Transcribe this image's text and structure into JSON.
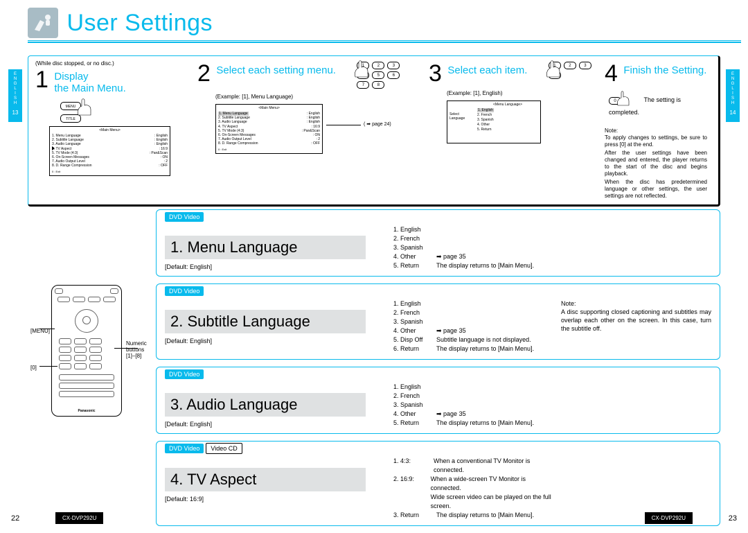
{
  "header": {
    "title": "User Settings"
  },
  "side": {
    "lang": "E\nN\nG\nL\nI\nS\nH",
    "page_left": "13",
    "page_right": "14"
  },
  "steps": {
    "s1": {
      "num": "1",
      "hint": "(While disc stopped, or no disc.)",
      "text": "Display\nthe Main Menu."
    },
    "s2": {
      "num": "2",
      "text": "Select each setting menu.",
      "example": "(Example: [1], Menu Language)",
      "ref": "( ➡ page 24)"
    },
    "s3": {
      "num": "3",
      "text": "Select each item.",
      "example": "(Example: [1], English)"
    },
    "s4": {
      "num": "4",
      "text": "Finish the Setting.",
      "done": "The setting is completed.",
      "note_label": "Note:",
      "note1": "To apply changes to settings, be sure to press [0] at the end.",
      "note2": "After the user settings have been changed and entered, the player returns to the start of the disc and begins playback.",
      "note3": "When the disc has predetermined language or other settings, the user settings are not reflected."
    },
    "menu_key": "MENU",
    "title_key": "TITLE",
    "kp": [
      "1",
      "2",
      "3",
      "4",
      "5",
      "6",
      "7",
      "8"
    ],
    "kp_short": [
      "1",
      "2",
      "3",
      "4"
    ],
    "kp_zero": "0"
  },
  "osd_main": {
    "title": "<Main Menu>",
    "rows": [
      [
        "1. Menu Language",
        "English"
      ],
      [
        "2. Subtitle Language",
        "English"
      ],
      [
        "3. Audio Language",
        "English"
      ],
      [
        "4. TV Aspect",
        "16:9"
      ],
      [
        "5. TV Mode (4:3)",
        "Pan&Scan"
      ],
      [
        "6. On-Screen Messages",
        "ON"
      ],
      [
        "7. Audio Output Level",
        "2"
      ],
      [
        "8. D. Range Compression",
        "OFF"
      ]
    ],
    "foot": "0 : Exit"
  },
  "osd_lang": {
    "title": "<Menu Language>",
    "label": "Select\nLanguage",
    "rows": [
      "1. English",
      "2. French",
      "3. Spanish",
      "4. Other",
      "5. Return"
    ]
  },
  "remote": {
    "label_menu": "[MENU]",
    "label_zero": "[0]",
    "label_num": "Numeric\nbuttons\n[1]–[8]"
  },
  "badges": {
    "dvd": "DVD Video",
    "vcd": "Video CD"
  },
  "settings": [
    {
      "title": "1. Menu Language",
      "default": "[Default: English]",
      "opts": [
        [
          "1. English",
          ""
        ],
        [
          "2. French",
          ""
        ],
        [
          "3. Spanish",
          ""
        ],
        [
          "4. Other",
          "➡ page 35"
        ],
        [
          "5. Return",
          "The display returns to [Main Menu]."
        ]
      ],
      "badges": [
        "dvd"
      ]
    },
    {
      "title": "2. Subtitle Language",
      "default": "[Default: English]",
      "opts": [
        [
          "1. English",
          ""
        ],
        [
          "2. French",
          ""
        ],
        [
          "3. Spanish",
          ""
        ],
        [
          "4. Other",
          "➡ page 35"
        ],
        [
          "5. Disp Off",
          "Subtitle language is not displayed."
        ],
        [
          "6. Return",
          "The display returns to [Main Menu]."
        ]
      ],
      "note_label": "Note:",
      "note": "A disc supporting closed captioning and subtitles may overlap each other on the screen. In this case, turn the subtitle off.",
      "badges": [
        "dvd"
      ]
    },
    {
      "title": "3. Audio Language",
      "default": "[Default: English]",
      "opts": [
        [
          "1. English",
          ""
        ],
        [
          "2. French",
          ""
        ],
        [
          "3. Spanish",
          ""
        ],
        [
          "4. Other",
          "➡ page 35"
        ],
        [
          "5. Return",
          "The display returns to [Main Menu]."
        ]
      ],
      "badges": [
        "dvd"
      ]
    },
    {
      "title": "4. TV Aspect",
      "default": "[Default: 16:9]",
      "opts": [
        [
          "1. 4:3:",
          "When a conventional TV Monitor is connected."
        ],
        [
          "2. 16:9:",
          "When a wide-screen TV Monitor is connected.\nWide screen video can be played on the full screen."
        ],
        [
          "3. Return",
          "The display returns to [Main Menu]."
        ]
      ],
      "badges": [
        "dvd",
        "vcd"
      ]
    }
  ],
  "footer": {
    "page_l": "22",
    "page_r": "23",
    "model": "CX-DVP292U"
  }
}
